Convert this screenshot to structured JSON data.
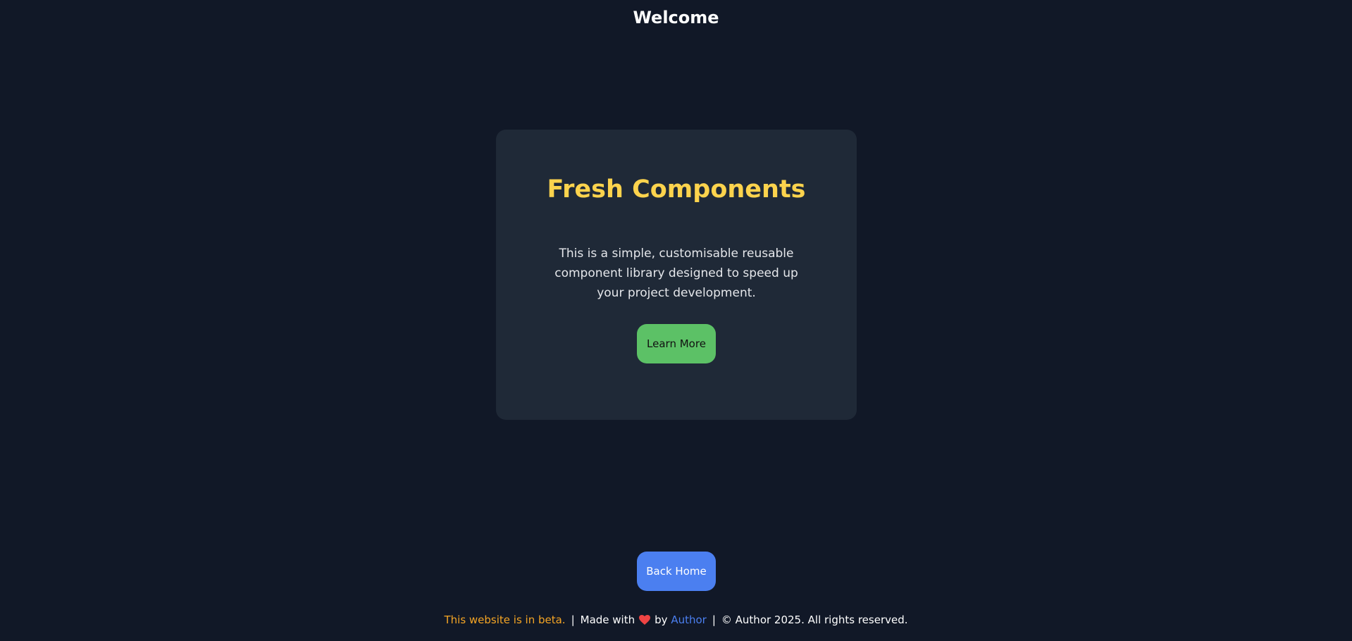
{
  "header": {
    "title": "Welcome"
  },
  "card": {
    "title": "Fresh Components",
    "description": "This is a simple, customisable reusable component library designed to speed up your project development.",
    "button_label": "Learn More"
  },
  "back_button": {
    "label": "Back Home"
  },
  "footer": {
    "beta_notice": "This website is in beta.",
    "separator": "|",
    "made_with": "Made with",
    "heart_icon": "heart-icon",
    "by": "by",
    "author_link": "Author",
    "copyright": "© Author 2025. All rights reserved."
  },
  "colors": {
    "background": "#111827",
    "card": "#1f2937",
    "title_accent": "#fcd34d",
    "learn_button": "#5cc166",
    "home_button": "#4b7ff0",
    "beta_text": "#f5a524",
    "link": "#4b7ff0",
    "heart": "#ef4444"
  }
}
